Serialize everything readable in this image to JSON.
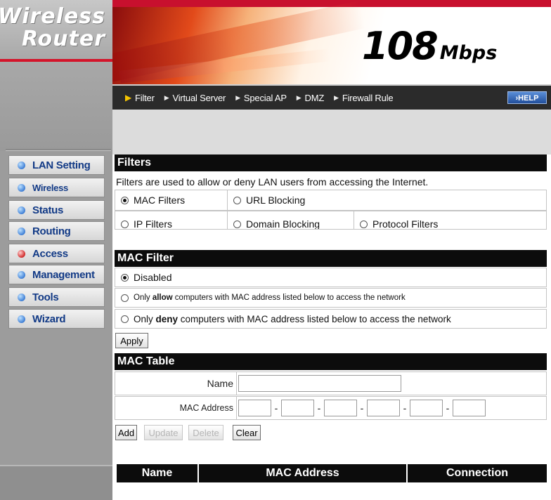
{
  "logo": {
    "line1": "Wireless",
    "line2": "Router"
  },
  "header": {
    "speed_number": "108",
    "speed_unit": "Mbps",
    "help_label": "HELP"
  },
  "nav": {
    "items": [
      "Filter",
      "Virtual Server",
      "Special AP",
      "DMZ",
      "Firewall Rule"
    ],
    "active": "Filter"
  },
  "sidebar": {
    "items": [
      "LAN Setting",
      "Wireless",
      "Status",
      "Routing",
      "Access",
      "Management",
      "Tools",
      "Wizard"
    ],
    "active": "Access"
  },
  "filters": {
    "title": "Filters",
    "description": "Filters are used to allow or deny LAN users from accessing the Internet.",
    "options": [
      "MAC Filters",
      "URL Blocking",
      "IP Filters",
      "Domain Blocking",
      "Protocol Filters"
    ],
    "selected": "MAC Filters"
  },
  "mac_filter": {
    "title": "MAC Filter",
    "disabled_label": "Disabled",
    "allow_prefix": "Only ",
    "allow_bold": "allow",
    "allow_suffix": " computers with MAC address listed below to access the network",
    "deny_prefix": "Only ",
    "deny_bold": "deny",
    "deny_suffix": " computers with MAC address listed below to access the network",
    "selected": "Disabled",
    "apply_label": "Apply"
  },
  "mac_table": {
    "title": "MAC Table",
    "name_label": "Name",
    "name_value": "",
    "mac_label": "MAC Address",
    "mac_values": [
      "",
      "",
      "",
      "",
      "",
      ""
    ],
    "mac_separator": "-",
    "buttons": {
      "add": "Add",
      "update": "Update",
      "delete": "Delete",
      "clear": "Clear"
    },
    "columns": [
      "Name",
      "MAC Address",
      "Connection"
    ]
  },
  "colors": {
    "brand_red": "#c8102e",
    "header_dark": "#0c0c0c",
    "menu_text": "#123a86"
  }
}
